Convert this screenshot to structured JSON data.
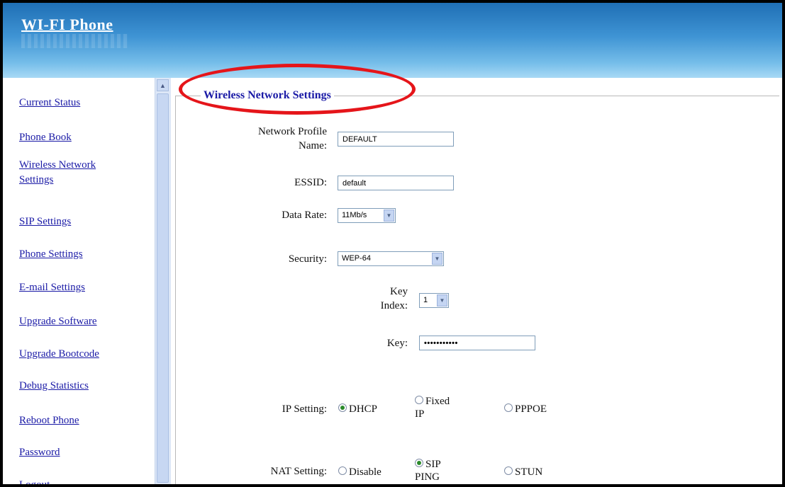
{
  "header": {
    "logo_text": "WI-FI Phone"
  },
  "sidebar": {
    "items": [
      {
        "label": "Current Status"
      },
      {
        "label": "Phone Book"
      },
      {
        "label_line1": "Wireless Network",
        "label_line2": "Settings"
      },
      {
        "label": "SIP Settings"
      },
      {
        "label": "Phone Settings"
      },
      {
        "label": "E-mail Settings"
      },
      {
        "label": "Upgrade Software"
      },
      {
        "label": "Upgrade Bootcode"
      },
      {
        "label": "Debug Statistics"
      },
      {
        "label": "Reboot Phone"
      },
      {
        "label": "Password"
      },
      {
        "label": "Logout"
      }
    ]
  },
  "main": {
    "section_title": "Wireless Network Settings",
    "profile": {
      "label_line1": "Network Profile",
      "label_line2": "Name:",
      "value": "DEFAULT"
    },
    "essid": {
      "label": "ESSID:",
      "value": "default"
    },
    "data_rate": {
      "label": "Data Rate:",
      "value": "11Mb/s"
    },
    "security": {
      "label": "Security:",
      "value": "WEP-64"
    },
    "key_index": {
      "label_line1": "Key",
      "label_line2": "Index:",
      "value": "1"
    },
    "key": {
      "label": "Key:",
      "value": "•••••••••••"
    },
    "ip_setting": {
      "label": "IP Setting:",
      "options": [
        {
          "line1": "DHCP",
          "selected": true
        },
        {
          "line1": "Fixed",
          "line2": "IP",
          "selected": false
        },
        {
          "line1": "PPPOE",
          "selected": false
        }
      ]
    },
    "nat_setting": {
      "label": "NAT Setting:",
      "options": [
        {
          "line1": "Disable",
          "selected": false
        },
        {
          "line1": "SIP",
          "line2": "PING",
          "selected": true
        },
        {
          "line1": "STUN",
          "selected": false
        }
      ]
    }
  },
  "annotation": {
    "color": "#e5151a"
  }
}
